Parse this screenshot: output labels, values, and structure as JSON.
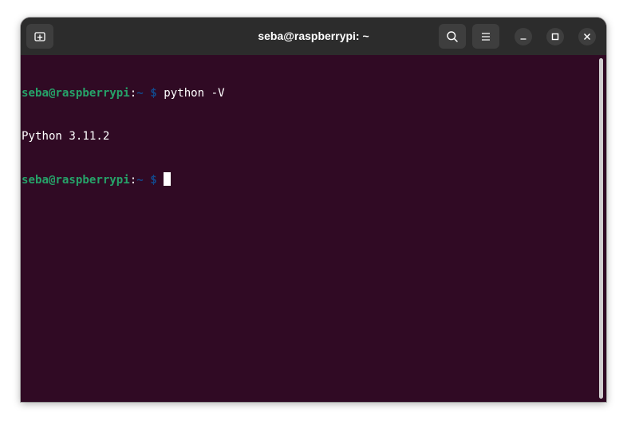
{
  "window": {
    "title": "seba@raspberrypi: ~"
  },
  "toolbar": {
    "new_tab_icon": "new-tab-icon",
    "search_icon": "search-icon",
    "menu_icon": "hamburger-menu-icon"
  },
  "window_controls": {
    "minimize_icon": "minimize-icon",
    "maximize_icon": "maximize-icon",
    "close_icon": "close-icon"
  },
  "terminal": {
    "lines": [
      {
        "user_host": "seba@raspberrypi",
        "colon": ":",
        "path": "~",
        "symbol": " $ ",
        "command": "python -V"
      },
      {
        "output": "Python 3.11.2"
      },
      {
        "user_host": "seba@raspberrypi",
        "colon": ":",
        "path": "~",
        "symbol": " $ ",
        "command": ""
      }
    ]
  },
  "colors": {
    "background": "#300a24",
    "titlebar": "#2c2c2c",
    "prompt_user": "#26a269",
    "prompt_path": "#12488b",
    "text": "#ffffff"
  }
}
